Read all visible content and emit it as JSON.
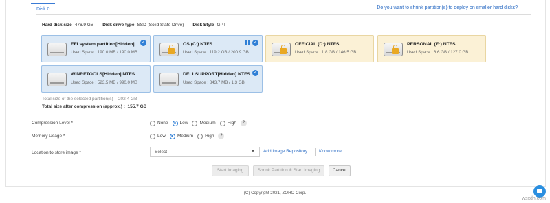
{
  "tab_label": "Disk 0",
  "shrink_link": "Do you want to shrink partition(s) to deploy on smaller hard disks?",
  "disk_info": {
    "size_label": "Hard disk size",
    "size_value": "476.9 GB",
    "type_label": "Disk drive type",
    "type_value": "SSD (Solid State Drive)",
    "style_label": "Disk Style",
    "style_value": "GPT"
  },
  "partitions": [
    {
      "name": "EFI system partition[Hidden]",
      "used": "Used Space : 190.0 MB / 190.0 MB",
      "selected": true,
      "windows": false,
      "locked": false
    },
    {
      "name": "OS (C:) NTFS",
      "used": "Used Space : 119.2 GB / 200.9 GB",
      "selected": true,
      "windows": true,
      "locked": true
    },
    {
      "name": "OFFICIAL (D:) NTFS",
      "used": "Used Space : 1.8 GB / 146.5 GB",
      "selected": false,
      "windows": false,
      "locked": true
    },
    {
      "name": "PERSONAL (E:) NTFS",
      "used": "Used Space : 6.6 GB / 127.0 GB",
      "selected": false,
      "windows": false,
      "locked": true
    },
    {
      "name": "WINRETOOLS[Hidden] NTFS",
      "used": "Used Space : 523.5 MB / 990.0 MB",
      "selected": true,
      "windows": false,
      "locked": false
    },
    {
      "name": "DELLSUPPORT[Hidden] NTFS",
      "used": "Used Space : 843.7 MB / 1.3 GB",
      "selected": true,
      "windows": false,
      "locked": false
    }
  ],
  "totals": {
    "selected_label": "Total size of the selected partition(s) :",
    "selected_value": "202.4 GB",
    "compressed_label": "Total size after compression (approx.) :",
    "compressed_value": "155.7 GB"
  },
  "compression": {
    "label": "Compression Level *",
    "options": [
      "None",
      "Low",
      "Medium",
      "High"
    ],
    "selected": "Low"
  },
  "memory": {
    "label": "Memory Usage *",
    "options": [
      "Low",
      "Medium",
      "High"
    ],
    "selected": "Medium"
  },
  "location": {
    "label": "Location to store image *",
    "select_value": "Select",
    "add_repo": "Add Image Repository",
    "know_more": "Know more"
  },
  "buttons": {
    "start": "Start Imaging",
    "shrink_start": "Shrink Partition & Start Imaging",
    "cancel": "Cancel"
  },
  "footer": "(C) Copyright 2021, ZOHO Corp.",
  "watermark": "wsxdn.com",
  "help_glyph": "?",
  "colors": {
    "accent": "#2f7fd6",
    "selected_bg": "#dce9f6",
    "unselected_bg": "#fbf1d6"
  }
}
